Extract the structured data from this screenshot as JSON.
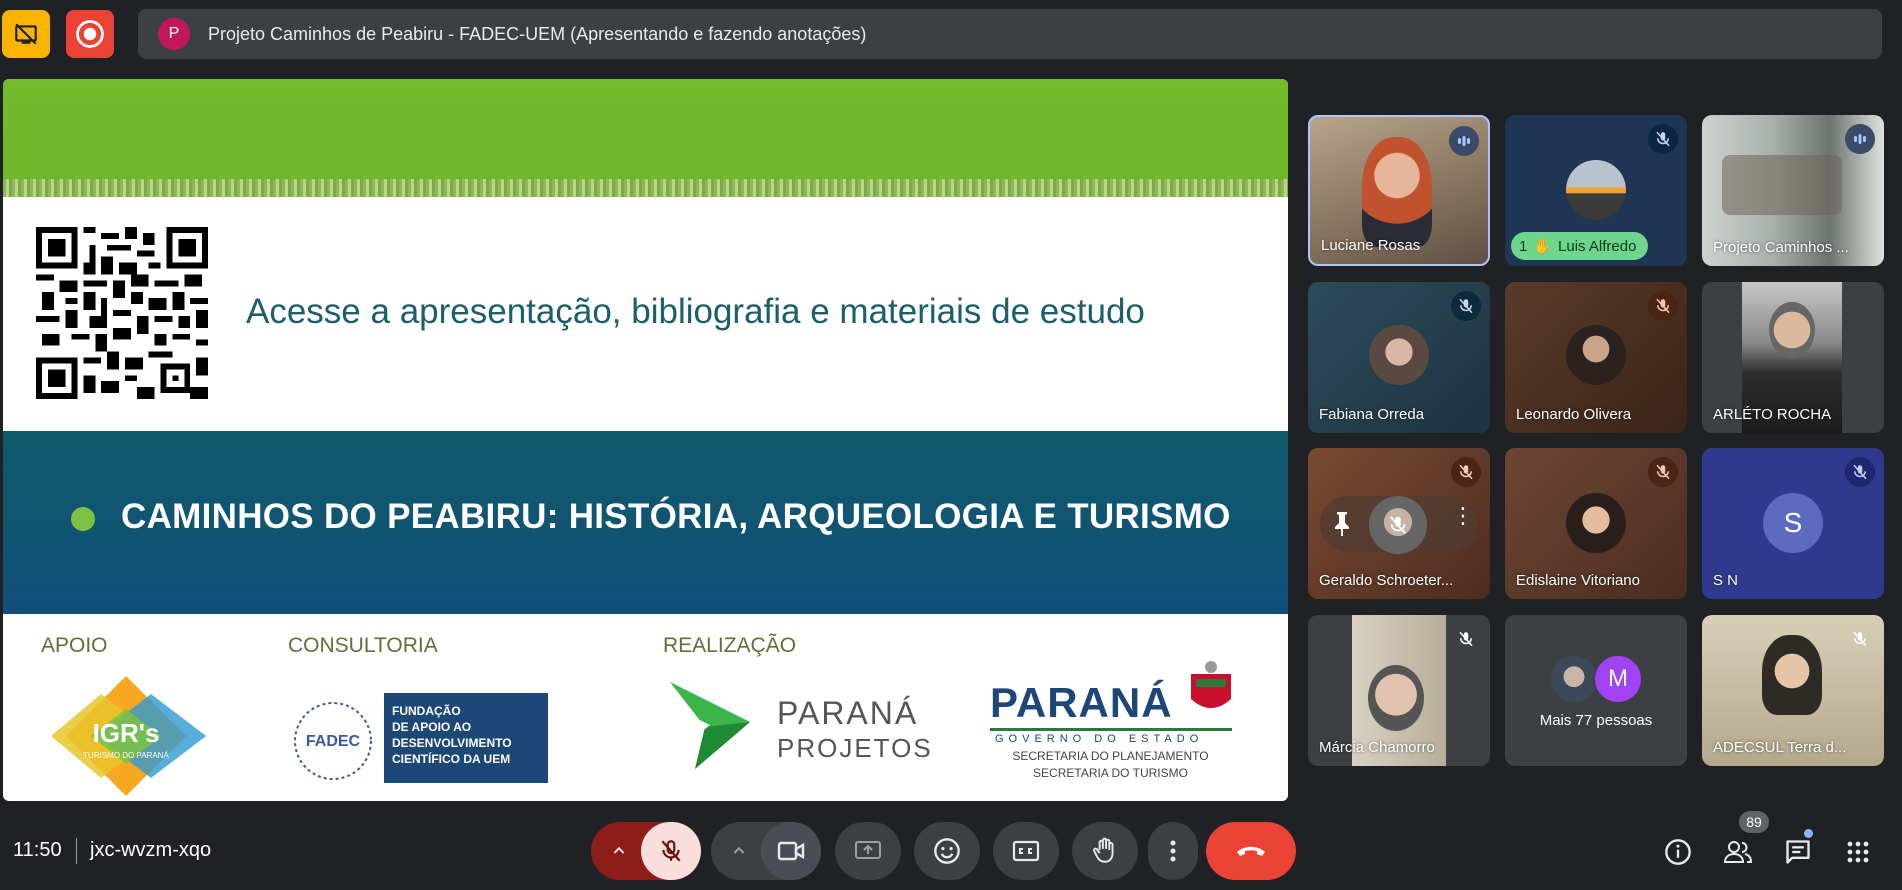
{
  "topbar": {
    "presentation_initial": "P",
    "presentation_title": "Projeto Caminhos de Peabiru - FADEC-UEM (Apresentando e fazendo anotações)",
    "stop_icon": "stop-presenting-icon",
    "record_icon": "recording-icon"
  },
  "slide": {
    "access_text": "Acesse a apresentação, bibliografia e materiais de estudo",
    "course_title": "CAMINHOS DO PEABIRU: HISTÓRIA, ARQUEOLOGIA E TURISMO",
    "label_apoio": "APOIO",
    "label_consultoria": "CONSULTORIA",
    "label_realizacao": "REALIZAÇÃO",
    "igr_logo_text": "IGR's",
    "igr_logo_sub": "TURISMO DO PARANÁ",
    "fadec_lines": [
      "FUNDAÇÃO",
      "DE APOIO AO",
      "DESENVOLVIMENTO",
      "CIENTÍFICO DA UEM"
    ],
    "fadec_word": "FADEC",
    "pp_line1": "PARANÁ",
    "pp_line2": "PROJETOS",
    "parana_word": "PARANÁ",
    "parana_gov": "GOVERNO DO ESTADO",
    "parana_sec1": "SECRETARIA DO PLANEJAMENTO",
    "parana_sec2": "SECRETARIA DO TURISMO"
  },
  "participants": [
    {
      "name": "Luciane Rosas",
      "status": "speaking",
      "kind": "video"
    },
    {
      "name": "Luis Alfredo",
      "status": "muted",
      "kind": "avatar",
      "hand_count": "1"
    },
    {
      "name": "Projeto Caminhos ...",
      "status": "speaking",
      "kind": "video"
    },
    {
      "name": "Fabiana Orreda",
      "status": "muted",
      "kind": "avatar"
    },
    {
      "name": "Leonardo Olivera",
      "status": "muted",
      "kind": "avatar"
    },
    {
      "name": "ARLÉTO ROCHA",
      "status": "",
      "kind": "video"
    },
    {
      "name": "Geraldo Schroeter...",
      "status": "muted",
      "kind": "avatar"
    },
    {
      "name": "Edislaine Vitoriano",
      "status": "muted",
      "kind": "avatar"
    },
    {
      "name": "S N",
      "status": "muted",
      "kind": "letter",
      "initial": "S"
    },
    {
      "name": "Márcia Chamorro",
      "status": "muted",
      "kind": "video"
    },
    {
      "name": "Mais 77 pessoas",
      "status": "",
      "kind": "more",
      "initial": "M"
    },
    {
      "name": "ADECSUL Terra d...",
      "status": "muted",
      "kind": "video"
    }
  ],
  "bottombar": {
    "time": "11:50",
    "meeting_code": "jxc-wvzm-xqo",
    "people_count": "89"
  },
  "colors": {
    "end_call": "#ea4335",
    "mic_off_bg": "#f9dedc",
    "mic_chevron_bg": "#8c1d18",
    "panel": "#3c4043",
    "page_bg": "#202124"
  }
}
